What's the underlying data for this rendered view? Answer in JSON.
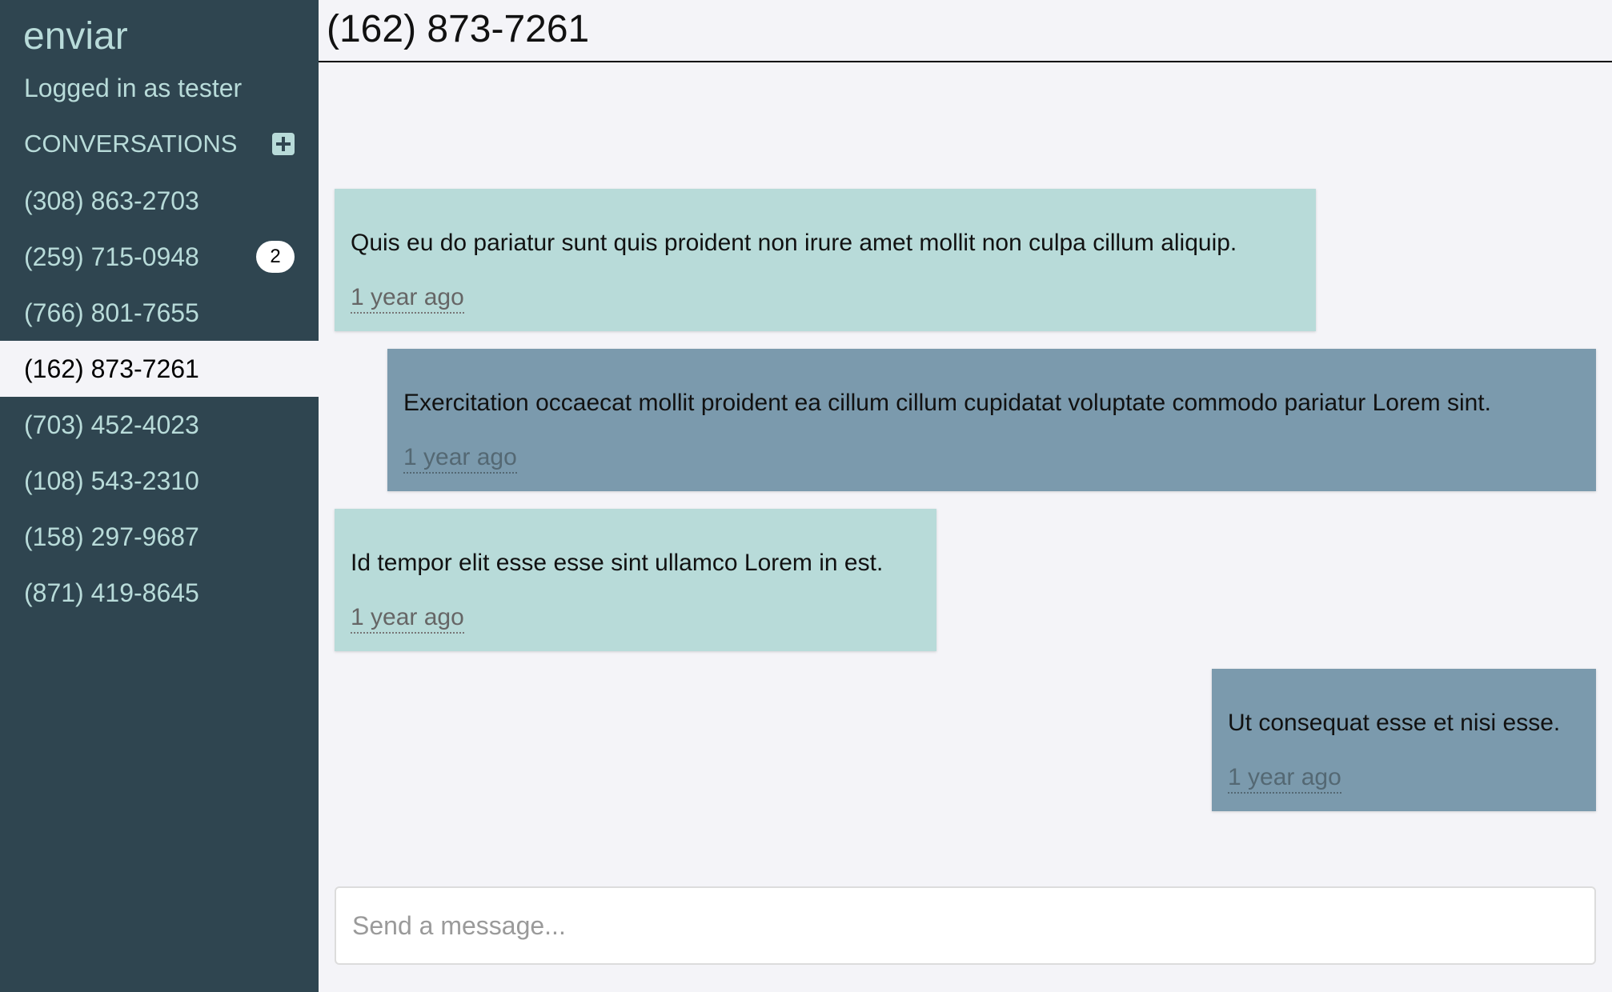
{
  "app": {
    "brand": "enviar",
    "logged_in": "Logged in as tester"
  },
  "sidebar": {
    "conversations_label": "CONVERSATIONS",
    "add_icon": "plus-square-icon",
    "items": [
      {
        "label": "(308) 863-2703",
        "badge": ""
      },
      {
        "label": "(259) 715-0948",
        "badge": "2"
      },
      {
        "label": "(766) 801-7655",
        "badge": ""
      },
      {
        "label": "(162) 873-7261",
        "badge": "",
        "active": true
      },
      {
        "label": "(703) 452-4023",
        "badge": ""
      },
      {
        "label": "(108) 543-2310",
        "badge": ""
      },
      {
        "label": "(158) 297-9687",
        "badge": ""
      },
      {
        "label": "(871) 419-8645",
        "badge": ""
      }
    ]
  },
  "chat": {
    "title": "(162) 873-7261",
    "messages": [
      {
        "direction": "incoming",
        "text": "Quis eu do pariatur sunt quis proident non irure amet mollit non culpa cillum aliquip.",
        "time": "1 year ago"
      },
      {
        "direction": "outgoing",
        "text": "Exercitation occaecat mollit proident ea cillum cillum cupidatat voluptate commodo pariatur Lorem sint.",
        "time": "1 year ago"
      },
      {
        "direction": "incoming",
        "text": "Id tempor elit esse esse sint ullamco Lorem in est.",
        "time": "1 year ago"
      },
      {
        "direction": "outgoing",
        "text": "Ut consequat esse et nisi esse.",
        "time": "1 year ago"
      }
    ],
    "compose": {
      "value": "",
      "placeholder": "Send a message..."
    }
  },
  "colors": {
    "sidebar_bg": "#2f4550",
    "sidebar_text": "#b8dbd9",
    "incoming_bubble": "#b8dbd9",
    "outgoing_bubble": "#7b9aad",
    "main_bg": "#f4f4f8"
  }
}
